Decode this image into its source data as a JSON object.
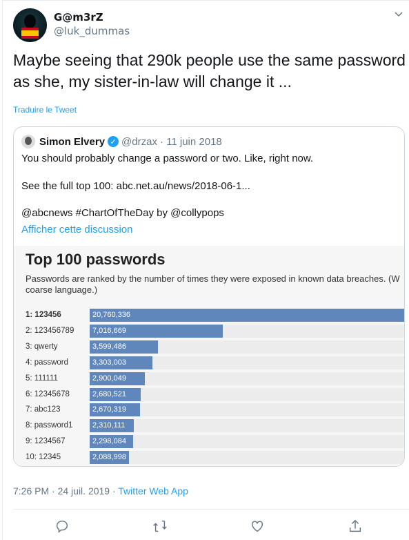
{
  "author": {
    "name": "G@m3rZ",
    "handle": "@luk_dummas"
  },
  "tweet": {
    "text": "Maybe seeing that 290k people use the same password as she, my sister-in-law will change it ...",
    "translate_label": "Traduire le Tweet"
  },
  "quoted": {
    "name": "Simon Elvery",
    "handle": "@drzax",
    "date": "· 11 juin 2018",
    "lines": [
      "You should probably change a password or two. Like, right now.",
      "See the full top 100: abc.net.au/news/2018-06-1...",
      "@abcnews #ChartOfTheDay by @collypops"
    ],
    "show_thread": "Afficher cette discussion"
  },
  "chart_data": {
    "type": "bar",
    "title": "Top 100 passwords",
    "subtitle": "Passwords are ranked by the number of times they were exposed in known data breaches. (W",
    "subtitle2": "coarse language.)",
    "categories": [
      "1: 123456",
      "2: 123456789",
      "3: qwerty",
      "4: password",
      "5: 111111",
      "6: 12345678",
      "7: abc123",
      "8: password1",
      "9: 1234567",
      "10: 12345"
    ],
    "values": [
      20760336,
      7016669,
      3599486,
      3303003,
      2900049,
      2680521,
      2670319,
      2310111,
      2298084,
      2088998
    ],
    "labels": [
      "20,760,336",
      "7,016,669",
      "3,599,486",
      "3,303,003",
      "2,900,049",
      "2,680,521",
      "2,670,319",
      "2,310,111",
      "2,298,084",
      "2,088,998"
    ],
    "color": "#5f87bb"
  },
  "footer": {
    "time": "7:26 PM · 24 juil. 2019 · ",
    "source": "Twitter Web App"
  },
  "colors": {
    "accent": "#1da1f2",
    "muted": "#657786"
  }
}
